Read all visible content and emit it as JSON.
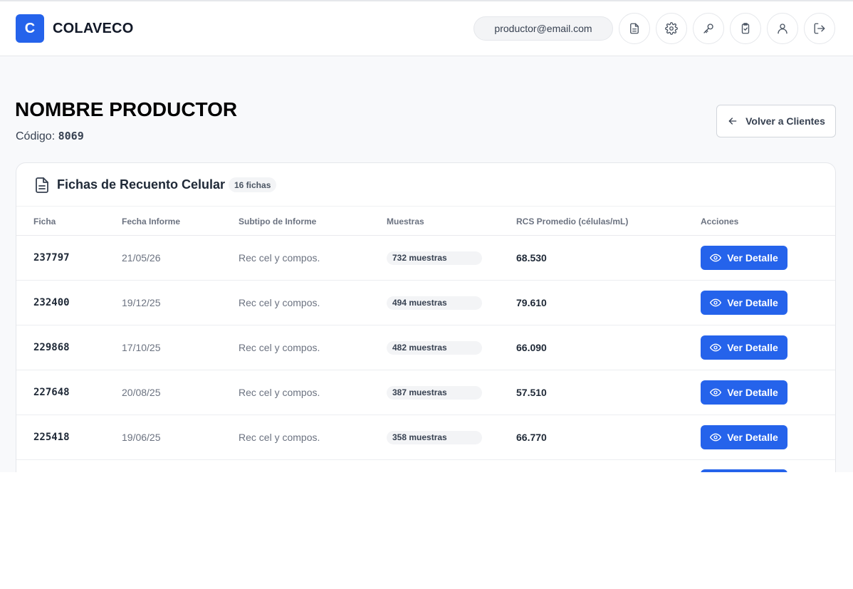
{
  "header": {
    "logo_letter": "C",
    "brand": "COLAVECO",
    "email": "productor@email.com",
    "icons": [
      "document-icon",
      "gear-icon",
      "key-icon",
      "clipboard-check-icon",
      "user-icon",
      "logout-icon"
    ]
  },
  "page": {
    "title": "NOMBRE PRODUCTOR",
    "code_label": "Código:",
    "code_value": "8069",
    "back_label": "Volver a Clientes"
  },
  "card": {
    "title": "Fichas de Recuento Celular",
    "count_badge": "16 fichas",
    "columns": [
      "Ficha",
      "Fecha Informe",
      "Subtipo de Informe",
      "Muestras",
      "RCS Promedio (células/mL)",
      "Acciones"
    ],
    "rows": [
      {
        "ficha": "237797",
        "fecha": "21/05/26",
        "subtipo": "Rec cel y compos.",
        "muestras": "732 muestras",
        "rcs": "68.530",
        "action": "Ver Detalle"
      },
      {
        "ficha": "232400",
        "fecha": "19/12/25",
        "subtipo": "Rec cel y compos.",
        "muestras": "494 muestras",
        "rcs": "79.610",
        "action": "Ver Detalle"
      },
      {
        "ficha": "229868",
        "fecha": "17/10/25",
        "subtipo": "Rec cel y compos.",
        "muestras": "482 muestras",
        "rcs": "66.090",
        "action": "Ver Detalle"
      },
      {
        "ficha": "227648",
        "fecha": "20/08/25",
        "subtipo": "Rec cel y compos.",
        "muestras": "387 muestras",
        "rcs": "57.510",
        "action": "Ver Detalle"
      },
      {
        "ficha": "225418",
        "fecha": "19/06/25",
        "subtipo": "Rec cel y compos.",
        "muestras": "358 muestras",
        "rcs": "66.770",
        "action": "Ver Detalle"
      }
    ]
  },
  "colors": {
    "accent": "#2563eb",
    "page_bg": "#f8f9fb",
    "text_muted": "#6b7280"
  }
}
